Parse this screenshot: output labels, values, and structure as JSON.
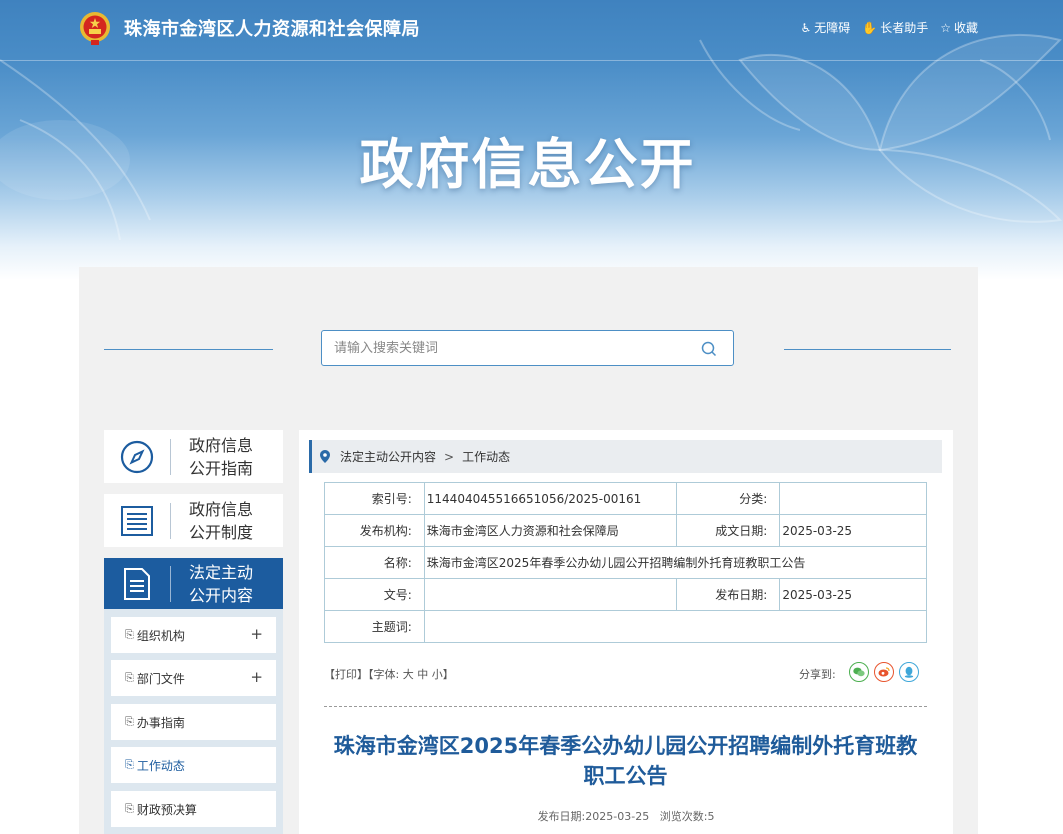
{
  "header": {
    "site_title": "珠海市金湾区人力资源和社会保障局",
    "hero_title": "政府信息公开",
    "links": [
      {
        "icon": "accessibility-icon",
        "label": "无障碍"
      },
      {
        "icon": "elder-helper-icon",
        "label": "长者助手"
      },
      {
        "icon": "star-icon",
        "label": "收藏"
      }
    ]
  },
  "search": {
    "placeholder": "请输入搜索关键词"
  },
  "nav": {
    "cards": [
      {
        "label": "政府信息\n公开指南",
        "icon": "compass-icon"
      },
      {
        "label": "政府信息\n公开制度",
        "icon": "list-icon"
      },
      {
        "label": "法定主动\n公开内容",
        "icon": "document-icon",
        "active": true
      }
    ],
    "sub_items": [
      {
        "label": "组织机构",
        "expandable": "+"
      },
      {
        "label": "部门文件",
        "expandable": "+"
      },
      {
        "label": "办事指南"
      },
      {
        "label": "工作动态",
        "active": true
      },
      {
        "label": "财政预决算"
      }
    ]
  },
  "breadcrumb": [
    "法定主动公开内容",
    "工作动态"
  ],
  "meta": {
    "index_label": "索引号:",
    "index_value": "114404045516651056/2025-00161",
    "category_label": "分类:",
    "category_value": "",
    "publisher_label": "发布机构:",
    "publisher_value": "珠海市金湾区人力资源和社会保障局",
    "created_label": "成文日期:",
    "created_value": "2025-03-25",
    "name_label": "名称:",
    "name_value": "珠海市金湾区2025年春季公办幼儿园公开招聘编制外托育班教职工公告",
    "docno_label": "文号:",
    "docno_value": "",
    "pubdate_label": "发布日期:",
    "pubdate_value": "2025-03-25",
    "subject_label": "主题词:",
    "subject_value": ""
  },
  "tools": {
    "print": "【打印】",
    "font_open": "【字体:",
    "font_large": "大",
    "font_medium": "中",
    "font_small": "小",
    "font_close": "】",
    "share_label": "分享到:",
    "share": [
      {
        "icon": "wechat-icon",
        "color": "#4caf50"
      },
      {
        "icon": "weibo-icon",
        "color": "#e8542d"
      },
      {
        "icon": "qq-icon",
        "color": "#3fa7d9"
      }
    ]
  },
  "article": {
    "title": "珠海市金湾区2025年春季公办幼儿园公开招聘编制外托育班教职工公告",
    "date_label": "发布日期:",
    "date": "2025-03-25",
    "views_label": "浏览次数:",
    "views": "5"
  },
  "colors": {
    "accent": "#1c5c9f",
    "title": "#1f5b9a",
    "line": "#4d8fc5"
  }
}
